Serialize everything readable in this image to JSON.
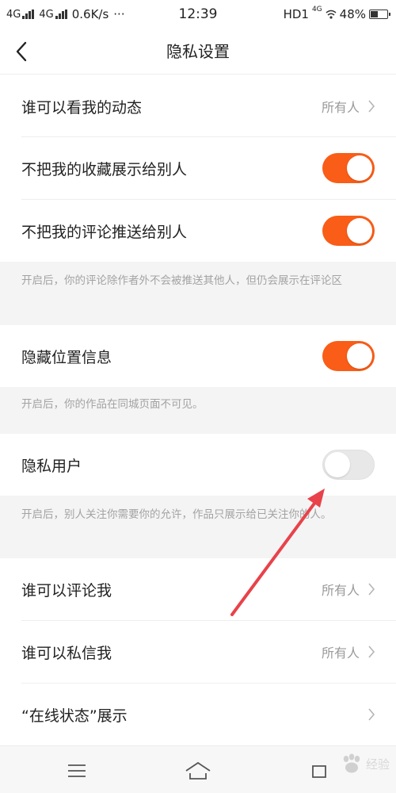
{
  "status_bar": {
    "network1": "4G",
    "network2": "4G",
    "speed": "0.6K/s",
    "more": "···",
    "time": "12:39",
    "hd": "HD1",
    "hd_sub": "4G",
    "battery_pct": "48%",
    "battery_level": 0.48
  },
  "header": {
    "title": "隐私设置"
  },
  "rows": {
    "who_can_see": {
      "label": "谁可以看我的动态",
      "value": "所有人"
    },
    "hide_favorites": {
      "label": "不把我的收藏展示给别人",
      "toggle_on": true
    },
    "hide_comments": {
      "label": "不把我的评论推送给别人",
      "toggle_on": true
    },
    "hide_location": {
      "label": "隐藏位置信息",
      "toggle_on": true
    },
    "private_user": {
      "label": "隐私用户",
      "toggle_on": false
    },
    "who_can_comment": {
      "label": "谁可以评论我",
      "value": "所有人"
    },
    "who_can_message": {
      "label": "谁可以私信我",
      "value": "所有人"
    },
    "online_status": {
      "label": "“在线状态”展示"
    }
  },
  "notes": {
    "comments_note": "开启后，你的评论除作者外不会被推送其他人，但仍会展示在评论区",
    "location_note": "开启后，你的作品在同城页面不可见。",
    "private_note": "开启后，别人关注你需要你的允许，作品只展示给已关注你的人。"
  },
  "watermark": {
    "text": "经验"
  },
  "colors": {
    "accent": "#f95d17",
    "toggle_off": "#e8e8e8",
    "note_bg": "#f4f4f4",
    "annotation_arrow": "#e8424a"
  }
}
